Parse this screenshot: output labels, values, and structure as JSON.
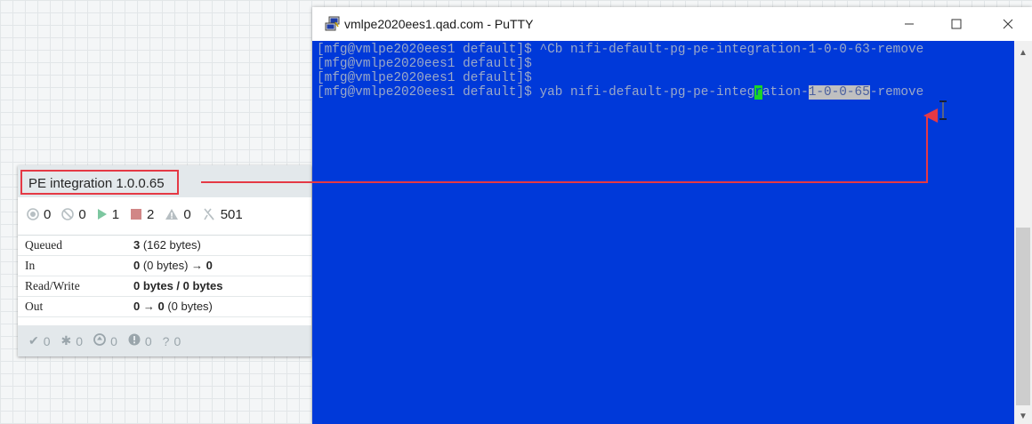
{
  "process_group": {
    "name": "PE integration 1.0.0.65",
    "stats": {
      "transmitting": "0",
      "not_transmitting": "0",
      "running": "1",
      "stopped": "2",
      "invalid": "0",
      "disabled": "501"
    },
    "rows": [
      {
        "label": "Queued",
        "value_bold": "3",
        "value_rest": " (162 bytes)"
      },
      {
        "label": "In",
        "value_bold": "0",
        "value_rest": " (0 bytes) → ",
        "value_tail": "0"
      },
      {
        "label": "Read/Write",
        "value_bold": "0 bytes / 0 bytes",
        "value_rest": ""
      },
      {
        "label": "Out",
        "value_bold": "0",
        "value_rest": " → ",
        "value_tail": "0",
        "value_after": " (0 bytes)"
      }
    ],
    "footer": {
      "up_to_date": "0",
      "locally_modified": "0",
      "stale": "0",
      "modified_stale": "0",
      "sync_failure": "0"
    }
  },
  "putty": {
    "title": "vmlpe2020ees1.qad.com - PuTTY",
    "lines": [
      "[mfg@vmlpe2020ees1 default]$ ^Cb nifi-default-pg-pe-integration-1-0-0-63-remove",
      "[mfg@vmlpe2020ees1 default]$",
      "[mfg@vmlpe2020ees1 default]$"
    ],
    "last_line": {
      "prefix": "[mfg@vmlpe2020ees1 default]$ yab nifi-default-pg-pe-integ",
      "cursor": "r",
      "middle": "ation-",
      "selected": "1-0-0-65",
      "suffix": "-remove"
    }
  },
  "colors": {
    "terminal_bg": "#0039d9",
    "terminal_fg": "#9ba9c8",
    "annotation": "#e53945",
    "cursor": "#1ad626"
  }
}
